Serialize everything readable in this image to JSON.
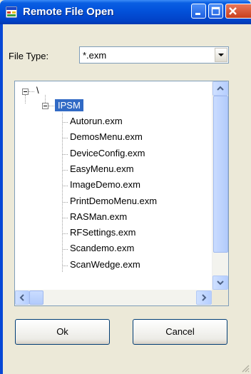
{
  "window": {
    "title": "Remote File Open",
    "icon": "app-window-icon",
    "controls": [
      "minimize-icon",
      "maximize-icon",
      "close-icon"
    ]
  },
  "file_type": {
    "label": "File Type:",
    "value": "*.exm"
  },
  "tree": {
    "root": "\\",
    "folder": "IPSM",
    "files": [
      "Autorun.exm",
      "DemosMenu.exm",
      "DeviceConfig.exm",
      "EasyMenu.exm",
      "ImageDemo.exm",
      "PrintDemoMenu.exm",
      "RASMan.exm",
      "RFSettings.exm",
      "Scandemo.exm",
      "ScanWedge.exm"
    ]
  },
  "buttons": {
    "ok": "Ok",
    "cancel": "Cancel"
  },
  "colors": {
    "titlebar": "#0353dc",
    "selection": "#316ac5",
    "dialog_bg": "#ece9d8"
  }
}
